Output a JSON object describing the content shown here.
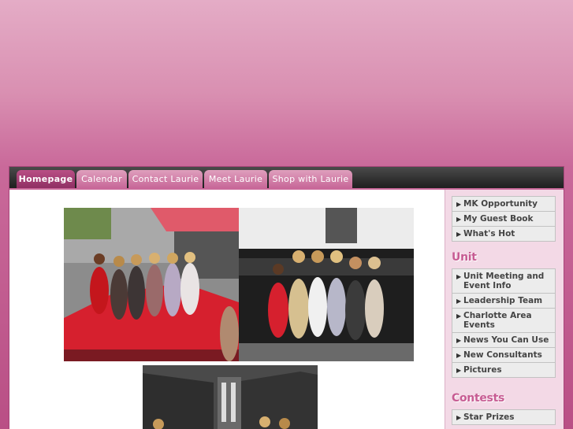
{
  "nav": {
    "tabs": [
      {
        "label": "Homepage",
        "active": true
      },
      {
        "label": "Calendar",
        "active": false
      },
      {
        "label": "Contact Laurie",
        "active": false
      },
      {
        "label": "Meet Laurie",
        "active": false
      },
      {
        "label": "Shop with Laurie",
        "active": false
      }
    ]
  },
  "sidebar": {
    "top_links": [
      "MK Opportunity",
      "My Guest Book",
      "What's Hot"
    ],
    "unit": {
      "title": "Unit",
      "links": [
        "Unit Meeting and Event Info",
        "Leadership Team",
        "Charlotte Area Events",
        "News You Can Use",
        "New Consultants",
        "Pictures"
      ]
    },
    "contests": {
      "title": "Contests",
      "links": [
        "Star Prizes"
      ]
    }
  },
  "colors": {
    "accent_pink": "#c75c93",
    "nav_dark": "#2a2a2a",
    "tab_pink": "#d784ad"
  },
  "icons": {
    "menu_bullet": "triangle-right-icon"
  }
}
